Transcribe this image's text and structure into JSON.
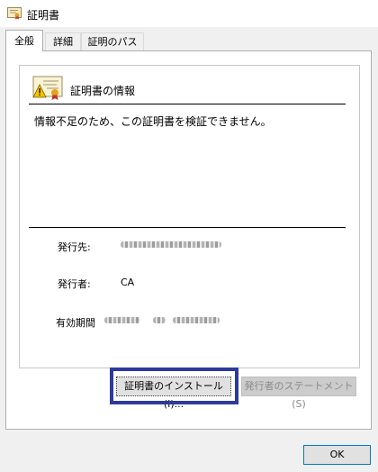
{
  "window": {
    "title": "証明書",
    "title_icon": "certificate-icon"
  },
  "tabs": [
    {
      "label": "全般",
      "active": true
    },
    {
      "label": "詳細",
      "active": false
    },
    {
      "label": "証明のパス",
      "active": false
    }
  ],
  "info": {
    "heading": "証明書の情報",
    "icon": "certificate-warning-icon",
    "warning": "情報不足のため、この証明書を検証できません。"
  },
  "fields": {
    "issued_to_label": "発行先:",
    "issued_by_label": "発行者:",
    "issued_by_value": "CA",
    "validity_label": "有効期間"
  },
  "buttons": {
    "install": "証明書のインストール(I)...",
    "statement": "発行者のステートメント(S)",
    "ok": "OK"
  },
  "colors": {
    "highlight": "#2e3a9c",
    "ok_border": "#0078d7"
  }
}
